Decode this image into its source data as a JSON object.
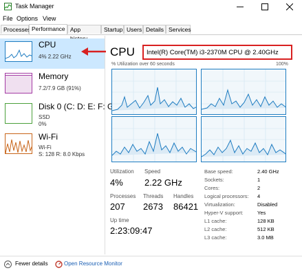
{
  "window": {
    "title": "Task Manager"
  },
  "menu": [
    "File",
    "Options",
    "View"
  ],
  "tabs": [
    "Processes",
    "Performance",
    "App history",
    "Startup",
    "Users",
    "Details",
    "Services"
  ],
  "active_tab": "Performance",
  "sidebar": [
    {
      "name": "CPU",
      "sub1": "4% 2.22 GHz",
      "sub2": "",
      "color": "#1e7cc1",
      "selected": true
    },
    {
      "name": "Memory",
      "sub1": "7.2/7.9 GB (91%)",
      "sub2": "",
      "color": "#a33aa3",
      "selected": false
    },
    {
      "name": "Disk 0 (C: D: E: F: G",
      "sub1": "SSD",
      "sub2": "0%",
      "color": "#4aa03a",
      "selected": false
    },
    {
      "name": "Wi-Fi",
      "sub1": "Wi-Fi",
      "sub2": "S: 128 R: 8.0 Kbps",
      "color": "#c86418",
      "selected": false
    }
  ],
  "main": {
    "title": "CPU",
    "model": "Intel(R) Core(TM) i3-2370M CPU @ 2.40GHz",
    "util_label": "% Utilization over 60 seconds",
    "util_max": "100%",
    "core_graphs": 4
  },
  "stats": {
    "utilization_label": "Utilization",
    "utilization": "4%",
    "speed_label": "Speed",
    "speed": "2.22 GHz",
    "processes_label": "Processes",
    "processes": "207",
    "threads_label": "Threads",
    "threads": "2673",
    "handles_label": "Handles",
    "handles": "86421",
    "uptime_label": "Up time",
    "uptime": "2:23:09:47"
  },
  "specs": [
    {
      "label": "Base speed:",
      "value": "2.40 GHz"
    },
    {
      "label": "Sockets:",
      "value": "1"
    },
    {
      "label": "Cores:",
      "value": "2"
    },
    {
      "label": "Logical processors:",
      "value": "4"
    },
    {
      "label": "Virtualization:",
      "value": "Disabled"
    },
    {
      "label": "Hyper-V support:",
      "value": "Yes"
    },
    {
      "label": "L1 cache:",
      "value": "128 KB"
    },
    {
      "label": "L2 cache:",
      "value": "512 KB"
    },
    {
      "label": "L3 cache:",
      "value": "3.0 MB"
    }
  ],
  "footer": {
    "fewer_details": "Fewer details",
    "open_monitor": "Open Resource Monitor"
  },
  "colors": {
    "accent": "#1e7cc1",
    "highlight": "#d82020",
    "selected_bg": "#cce8ff"
  }
}
